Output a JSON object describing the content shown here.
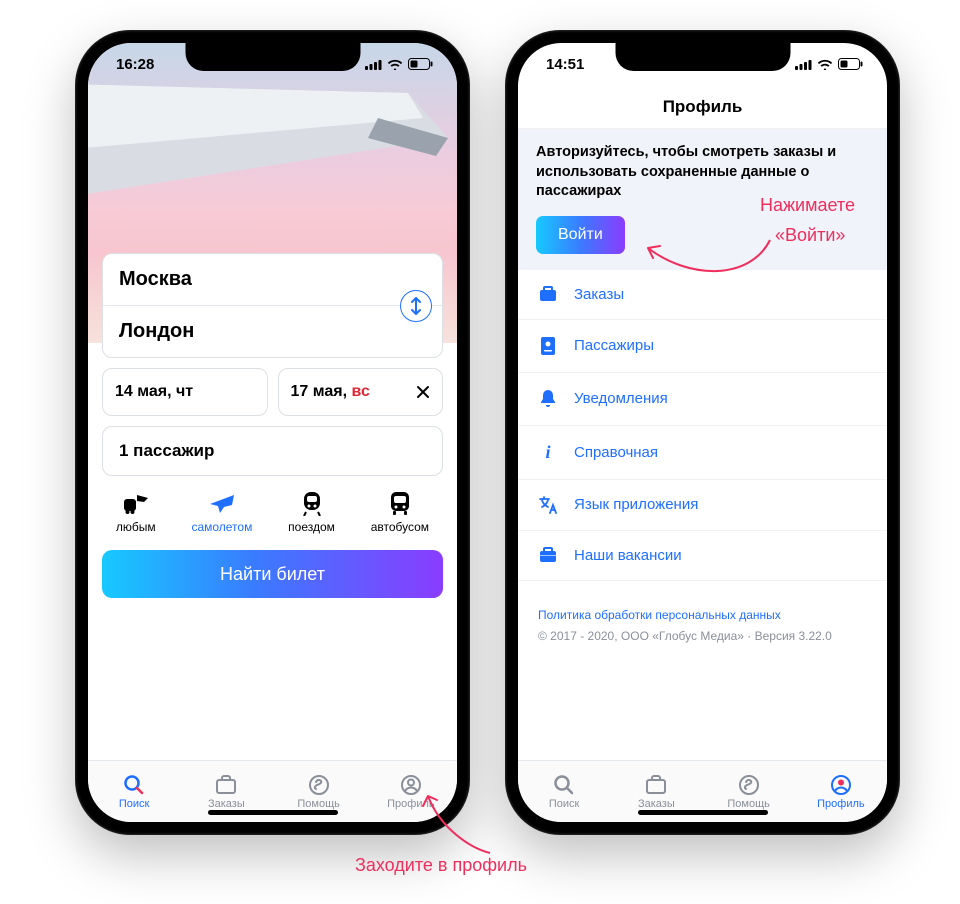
{
  "left": {
    "status_time": "16:28",
    "from": "Москва",
    "to": "Лондон",
    "date_out": "14 мая, чт",
    "date_back": {
      "text": "17 мая, ",
      "weekend": "вс"
    },
    "pax": "1 пассажир",
    "transport": {
      "any": "любым",
      "plane": "самолетом",
      "train": "поездом",
      "bus": "автобусом"
    },
    "find": "Найти билет",
    "tabs": {
      "search": "Поиск",
      "orders": "Заказы",
      "help": "Помощь",
      "profile": "Профиль"
    }
  },
  "right": {
    "status_time": "14:51",
    "title": "Профиль",
    "auth_msg": "Авторизуйтесь, чтобы смотреть заказы и использовать сохраненные данные о пассажирах",
    "login": "Войти",
    "menu": {
      "orders": "Заказы",
      "passengers": "Пассажиры",
      "notifications": "Уведомления",
      "help": "Справочная",
      "language": "Язык приложения",
      "jobs": "Наши вакансии"
    },
    "policy": "Политика обработки персональных данных",
    "copyright": "© 2017 - 2020, ООО «Глобус Медиа» · Версия 3.22.0"
  },
  "annotations": {
    "goto_profile": "Заходите в профиль",
    "press_login_1": "Нажимаете",
    "press_login_2": "«Войти»"
  }
}
